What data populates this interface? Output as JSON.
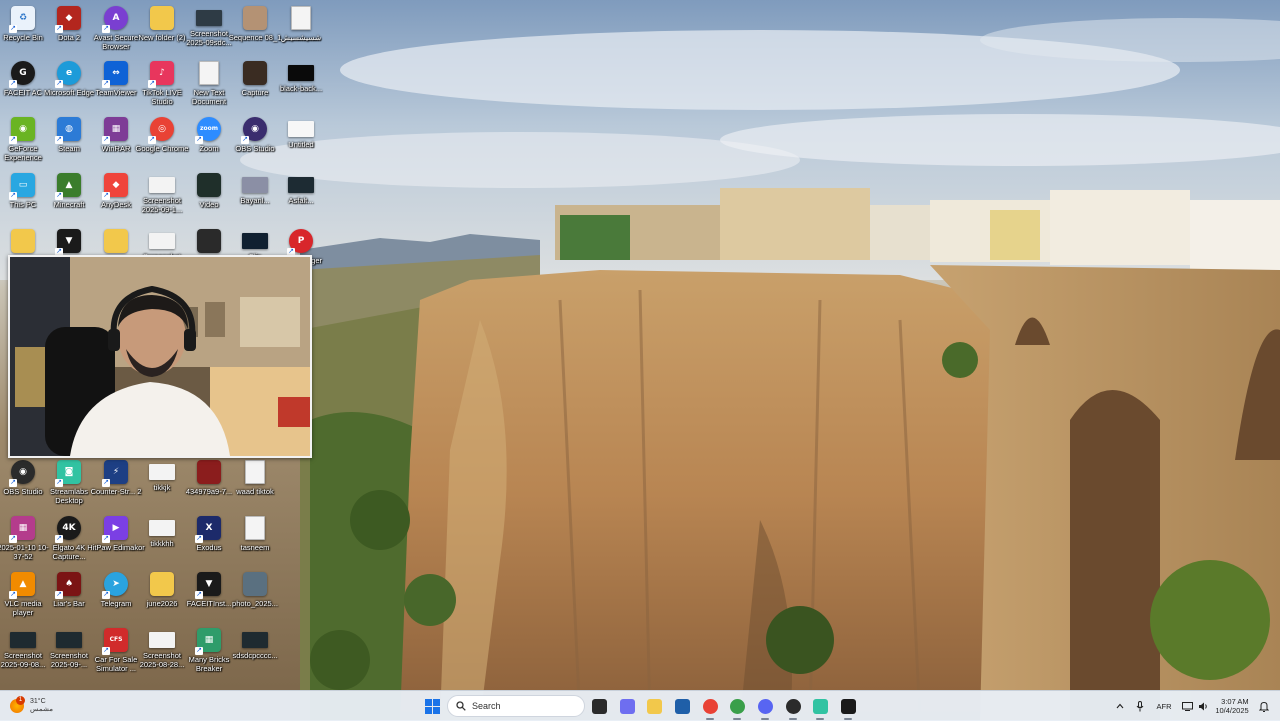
{
  "desktop": {
    "icons": [
      {
        "label": "Recycle Bin",
        "icon": "recycle-bin-icon",
        "bg": "#eaf2fb",
        "glyph": "♻",
        "gcolor": "#2a74c8"
      },
      {
        "label": "Dota 2",
        "icon": "dota2-icon",
        "bg": "#b3261e",
        "glyph": "◆"
      },
      {
        "label": "Avast Secure Browser",
        "icon": "avast-browser-icon",
        "bg": "#7a3fd1",
        "glyph": "A",
        "round": true
      },
      {
        "label": "New folder (2)",
        "icon": "folder-icon",
        "bg": "#f2c84b"
      },
      {
        "label": "Screenshot 2025-09sdc...",
        "icon": "image-file-icon",
        "bg": "#2e3b45",
        "wide": true
      },
      {
        "label": "Sequence 08_1",
        "icon": "video-file-icon",
        "bg": "#b49274"
      },
      {
        "label": "شسيشسيش",
        "icon": "document-file-icon",
        "file": true
      },
      {
        "label": "FACEIT AC",
        "icon": "faceit-ac-icon",
        "bg": "#1a1a1a",
        "glyph": "G",
        "round": true
      },
      {
        "label": "Microsoft Edge",
        "icon": "edge-icon",
        "bg": "#1d9bd9",
        "glyph": "e",
        "round": true
      },
      {
        "label": "TeamViewer",
        "icon": "teamviewer-icon",
        "bg": "#0e62d6",
        "glyph": "⇔"
      },
      {
        "label": "TikTok LIVE Studio",
        "icon": "tiktok-live-icon",
        "bg": "#e8365d",
        "glyph": "♪"
      },
      {
        "label": "New Text Document",
        "icon": "text-file-icon",
        "file": true
      },
      {
        "label": "Capture",
        "icon": "image-file-icon",
        "bg": "#3a2c22"
      },
      {
        "label": "black-back...",
        "icon": "image-file-icon",
        "bg": "#0a0a0a",
        "wide": true
      },
      {
        "label": "GeForce Experience",
        "icon": "nvidia-icon",
        "bg": "#6ab423",
        "glyph": "◉"
      },
      {
        "label": "Steam",
        "icon": "steam-icon",
        "bg": "#2c7bd6",
        "glyph": "◍"
      },
      {
        "label": "WinRAR",
        "icon": "winrar-icon",
        "bg": "#7e3c96",
        "glyph": "▦"
      },
      {
        "label": "Google Chrome",
        "icon": "chrome-icon",
        "bg": "#e94235",
        "glyph": "◎",
        "round": true
      },
      {
        "label": "Zoom",
        "icon": "zoom-icon",
        "bg": "#2d8cff",
        "glyph": "zoom",
        "round": true
      },
      {
        "label": "OBS Studio",
        "icon": "obs-icon",
        "bg": "#3a2d6e",
        "glyph": "◉",
        "round": true
      },
      {
        "label": "Untitled",
        "icon": "image-file-icon",
        "bg": "#f7f7f7",
        "wide": true
      },
      {
        "label": "This PC",
        "icon": "this-pc-icon",
        "bg": "#29a7e1",
        "glyph": "▭"
      },
      {
        "label": "Minecraft",
        "icon": "game-icon",
        "bg": "#3b7d2c",
        "glyph": "▲"
      },
      {
        "label": "AnyDesk",
        "icon": "anydesk-icon",
        "bg": "#ef443b",
        "glyph": "◆"
      },
      {
        "label": "Screenshot 2025-09-1...",
        "icon": "image-file-icon",
        "bg": "#f3f3f3",
        "wide": true
      },
      {
        "label": "Video",
        "icon": "video-file-icon",
        "bg": "#1f2f2a"
      },
      {
        "label": "Bayanl...",
        "icon": "image-file-icon",
        "bg": "#8b8fa5",
        "wide": true
      },
      {
        "label": "Asfalt...",
        "icon": "image-file-icon",
        "bg": "#1d2b33",
        "wide": true
      },
      {
        "label": "Folder",
        "icon": "folder-icon",
        "bg": "#f2c84b"
      },
      {
        "label": "FACEIT",
        "icon": "faceit-icon",
        "bg": "#1a1a1a",
        "glyph": "▼"
      },
      {
        "label": "New folder",
        "icon": "folder-icon",
        "bg": "#f2c84b"
      },
      {
        "label": "Screenshot",
        "icon": "image-file-icon",
        "bg": "#f3f3f3",
        "wide": true
      },
      {
        "label": "Video 2",
        "icon": "video-file-icon",
        "bg": "#2a2a2a"
      },
      {
        "label": "Clip",
        "icon": "image-file-icon",
        "bg": "#102030",
        "wide": true
      },
      {
        "label": "PC Manager",
        "icon": "pc-manager-icon",
        "bg": "#d8262b",
        "glyph": "P",
        "round": true
      },
      {
        "label": "OBS Studio",
        "icon": "obs-icon",
        "bg": "#2b2b2b",
        "glyph": "◉",
        "round": true
      },
      {
        "label": "Streamlabs Desktop",
        "icon": "streamlabs-icon",
        "bg": "#31c3a2",
        "glyph": "◙"
      },
      {
        "label": "Counter-Str... 2",
        "icon": "counter-strike-icon",
        "bg": "#1d3f84",
        "glyph": "⚡"
      },
      {
        "label": "tikkjk",
        "icon": "image-file-icon",
        "bg": "#f3f3f3",
        "wide": true
      },
      {
        "label": "434979a9-7...",
        "icon": "video-file-icon",
        "bg": "#8b1d1d"
      },
      {
        "label": "waad tiktok",
        "icon": "text-file-icon",
        "file": true
      },
      {
        "label": "2025-01-10 10-37-52",
        "icon": "winrar-archive-icon",
        "bg": "#b43c8c",
        "glyph": "▦"
      },
      {
        "label": "Elgato 4K Capture...",
        "icon": "elgato-icon",
        "bg": "#1a1a1a",
        "glyph": "4K",
        "round": true
      },
      {
        "label": "HitPaw Edimakor",
        "icon": "hitpaw-icon",
        "bg": "#7b3fe4",
        "glyph": "▶"
      },
      {
        "label": "tikkkhh",
        "icon": "image-file-icon",
        "bg": "#f3f3f3",
        "wide": true
      },
      {
        "label": "Exodus",
        "icon": "exodus-icon",
        "bg": "#1c2a6a",
        "glyph": "X"
      },
      {
        "label": "tasneem",
        "icon": "text-file-icon",
        "file": true
      },
      {
        "label": "VLC media player",
        "icon": "vlc-icon",
        "bg": "#f18b00",
        "glyph": "▲"
      },
      {
        "label": "Liar's Bar",
        "icon": "game-icon",
        "bg": "#7b1414",
        "glyph": "♠"
      },
      {
        "label": "Telegram",
        "icon": "telegram-icon",
        "bg": "#2aa3df",
        "glyph": "➤",
        "round": true
      },
      {
        "label": "june2026",
        "icon": "folder-icon",
        "bg": "#f2c84b"
      },
      {
        "label": "FACEITInst...",
        "icon": "faceit-installer-icon",
        "bg": "#1a1a1a",
        "glyph": "▼"
      },
      {
        "label": "photo_2025...",
        "icon": "image-file-icon",
        "bg": "#5a7080"
      },
      {
        "label": "Screenshot 2025-09-08...",
        "icon": "image-file-icon",
        "bg": "#1e2a30",
        "wide": true
      },
      {
        "label": "Screenshot 2025-09-...",
        "icon": "image-file-icon",
        "bg": "#1e2a30",
        "wide": true
      },
      {
        "label": "Car For Sale Simulator ...",
        "icon": "car-for-sale-icon",
        "bg": "#d12b2b",
        "glyph": "CFS"
      },
      {
        "label": "Screenshot 2025-08-28...",
        "icon": "image-file-icon",
        "bg": "#f3f3f3",
        "wide": true
      },
      {
        "label": "Many Bricks Breaker",
        "icon": "game-icon",
        "bg": "#2f9c6a",
        "glyph": "▦"
      },
      {
        "label": "sdsdcpcccc...",
        "icon": "image-file-icon",
        "bg": "#1e2a30",
        "wide": true
      }
    ]
  },
  "webcam": {
    "label": "webcam-feed"
  },
  "taskbar": {
    "weather": {
      "temp": "31°C",
      "condition": "مشمس",
      "badge": "1"
    },
    "search_label": "Search",
    "apps": [
      {
        "name": "task-view-icon",
        "color": "#2b2b2b"
      },
      {
        "name": "copilot-icon",
        "color": "#6e6ef0"
      },
      {
        "name": "file-explorer-icon",
        "color": "#f2c84b"
      },
      {
        "name": "microsoft-store-icon",
        "color": "#1f5fa8"
      },
      {
        "name": "chrome-icon",
        "color": "#e94235",
        "round": true
      },
      {
        "name": "chrome-profile-icon",
        "color": "#3a9f4a",
        "round": true
      },
      {
        "name": "discord-icon",
        "color": "#5865f2",
        "round": true
      },
      {
        "name": "obs-icon",
        "color": "#2b2b2b",
        "round": true
      },
      {
        "name": "streamlabs-icon",
        "color": "#31c3a2"
      },
      {
        "name": "teamviewer-icon",
        "color": "#1a1a1a"
      }
    ],
    "tray": {
      "language": "AFR",
      "time": "3:07 AM",
      "date": "10/4/2025"
    }
  }
}
